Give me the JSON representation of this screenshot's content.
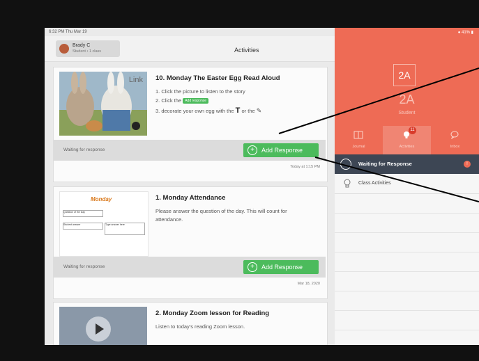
{
  "statusbar": {
    "time": "6:32 PM  Thu Mar 19",
    "battery": "● 41% ▮"
  },
  "header": {
    "user_name": "Brady C",
    "user_sub": "Student • 1 class",
    "title": "Activities"
  },
  "activities": [
    {
      "title": "10. Monday The Easter Egg Read Aloud",
      "thumb_label": "Link",
      "lines": [
        "1. Click the picture to listen to the story",
        "2. Click the",
        "3. decorate your own egg with the"
      ],
      "inline_tag": "Add response",
      "tool_T": "T",
      "tool_or": "or the",
      "status": "Waiting for response",
      "button": "Add Response",
      "timestamp": "Today at 1:15 PM"
    },
    {
      "title": "1. Monday Attendance",
      "thumb_label": "Monday",
      "thumb_fields": [
        "Question of the Day",
        "Student answer",
        "Type answer here"
      ],
      "lines": [
        "Please answer the question of the day. This will count for",
        "attendance."
      ],
      "status": "Waiting for response",
      "button": "Add Response",
      "timestamp": "Mar 18, 2020"
    },
    {
      "title": "2. Monday  Zoom lesson for Reading",
      "lines": [
        "Listen to today's reading Zoom lesson."
      ]
    }
  ],
  "sidebar": {
    "class_code": "2A",
    "class_name": "2A",
    "role": "Student",
    "tabs": [
      {
        "label": "Journal",
        "icon": "book-icon"
      },
      {
        "label": "Activities",
        "icon": "lightbulb-icon",
        "count": "11"
      },
      {
        "label": "Inbox",
        "icon": "chat-icon"
      }
    ],
    "waiting_label": "Waiting for Response",
    "waiting_dot": "!",
    "class_activities": "Class Activities"
  },
  "colors": {
    "accent": "#ee6b55",
    "green": "#4cbb5c",
    "dark": "#3d4654"
  }
}
